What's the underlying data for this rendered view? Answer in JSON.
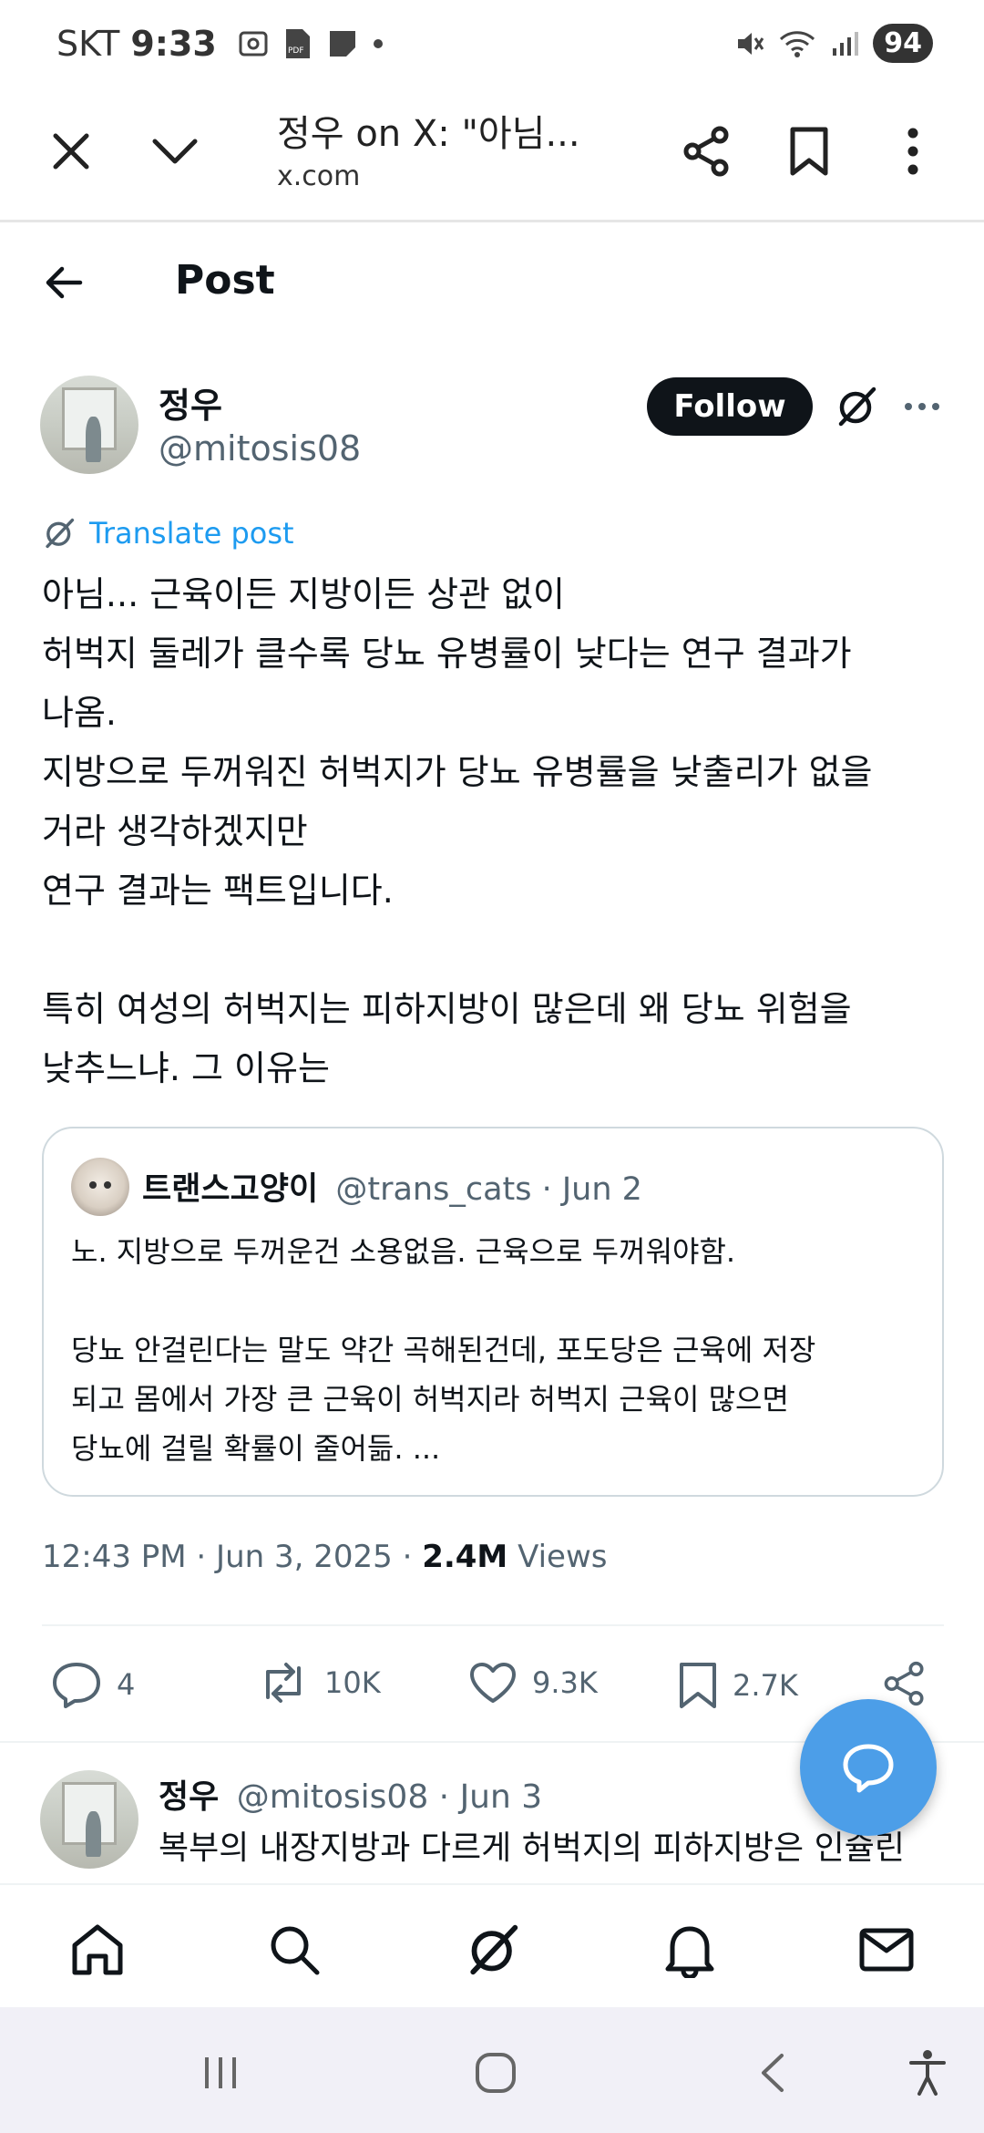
{
  "status_bar": {
    "carrier": "SKT",
    "time": "9:33",
    "battery": "94"
  },
  "browser": {
    "page_title": "정우 on X: \"아님...",
    "url": "x.com"
  },
  "header": {
    "title": "Post"
  },
  "post": {
    "author_name": "정우",
    "author_handle": "@mitosis08",
    "follow_label": "Follow",
    "translate_label": "Translate post",
    "lines": [
      "아님... 근육이든 지방이든 상관 없이",
      "허벅지 둘레가 클수록 당뇨 유병률이 낮다는 연구 결과가",
      "나옴.",
      "지방으로 두꺼워진 허벅지가 당뇨 유병률을 낮출리가 없을",
      "거라 생각하겠지만",
      "연구 결과는 팩트입니다.",
      "",
      "특히 여성의 허벅지는 피하지방이 많은데 왜 당뇨 위험을",
      "낮추느냐. 그 이유는"
    ],
    "timestamp": "12:43 PM · Jun 3, 2025 · ",
    "views_count": "2.4M",
    "views_label": " Views"
  },
  "quote": {
    "name": "트랜스고양이",
    "handle_date": "@trans_cats · Jun 2",
    "lines": [
      "노. 지방으로 두꺼운건 소용없음. 근육으로 두꺼워야함.",
      "",
      "당뇨 안걸린다는 말도 약간 곡해된건데, 포도당은 근육에 저장",
      "되고 몸에서 가장 큰 근육이 허벅지라 허벅지 근육이 많으면",
      "당뇨에 걸릴 확률이 줄어듦.  ..."
    ]
  },
  "actions": {
    "replies": "4",
    "reposts": "10K",
    "likes": "9.3K",
    "bookmarks": "2.7K"
  },
  "reply": {
    "name": "정우",
    "handle_date": "@mitosis08 · Jun 3",
    "text": "복부의 내장지방과 다르게 허벅지의 피하지방은 인슐린"
  },
  "colors": {
    "accent": "#1d9bf0",
    "fab": "#4c9ee8",
    "text": "#0f1419",
    "muted": "#536471"
  }
}
